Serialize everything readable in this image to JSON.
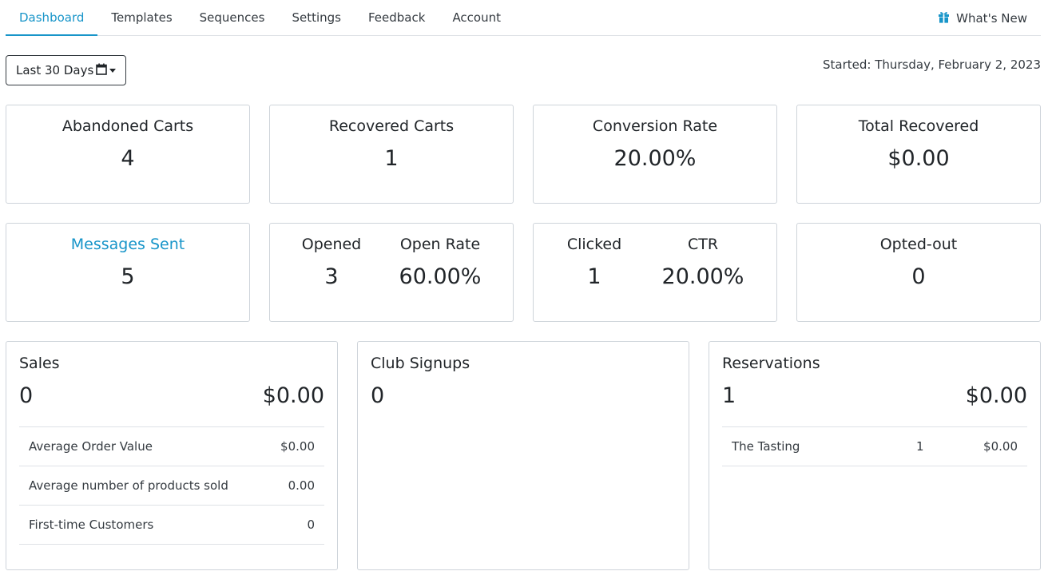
{
  "nav": {
    "tabs": [
      {
        "label": "Dashboard"
      },
      {
        "label": "Templates"
      },
      {
        "label": "Sequences"
      },
      {
        "label": "Settings"
      },
      {
        "label": "Feedback"
      },
      {
        "label": "Account"
      }
    ],
    "whats_new": "What's New",
    "active_tab": "Dashboard"
  },
  "controls": {
    "range_label": "Last 30 Days",
    "started": "Started: Thursday, February 2, 2023"
  },
  "stats": {
    "abandoned_carts": {
      "title": "Abandoned Carts",
      "value": "4"
    },
    "recovered_carts": {
      "title": "Recovered Carts",
      "value": "1"
    },
    "conversion_rate": {
      "title": "Conversion Rate",
      "value": "20.00%"
    },
    "total_recovered": {
      "title": "Total Recovered",
      "value": "$0.00"
    },
    "messages_sent": {
      "title": "Messages Sent",
      "value": "5"
    },
    "opened": {
      "title": "Opened",
      "value": "3"
    },
    "open_rate": {
      "title": "Open Rate",
      "value": "60.00%"
    },
    "clicked": {
      "title": "Clicked",
      "value": "1"
    },
    "ctr": {
      "title": "CTR",
      "value": "20.00%"
    },
    "opted_out": {
      "title": "Opted-out",
      "value": "0"
    }
  },
  "sales": {
    "title": "Sales",
    "count": "0",
    "amount": "$0.00",
    "rows": [
      {
        "label": "Average Order Value",
        "value": "$0.00"
      },
      {
        "label": "Average number of products sold",
        "value": "0.00"
      },
      {
        "label": "First-time Customers",
        "value": "0"
      }
    ]
  },
  "club_signups": {
    "title": "Club Signups",
    "count": "0"
  },
  "reservations": {
    "title": "Reservations",
    "count": "1",
    "amount": "$0.00",
    "rows": [
      {
        "label": "The Tasting",
        "count": "1",
        "value": "$0.00"
      }
    ]
  },
  "colors": {
    "accent": "#1895c9",
    "border": "#ced4da",
    "text": "#212529"
  },
  "icons": {
    "whats_new": "gift-icon",
    "range": "calendar-icon"
  }
}
